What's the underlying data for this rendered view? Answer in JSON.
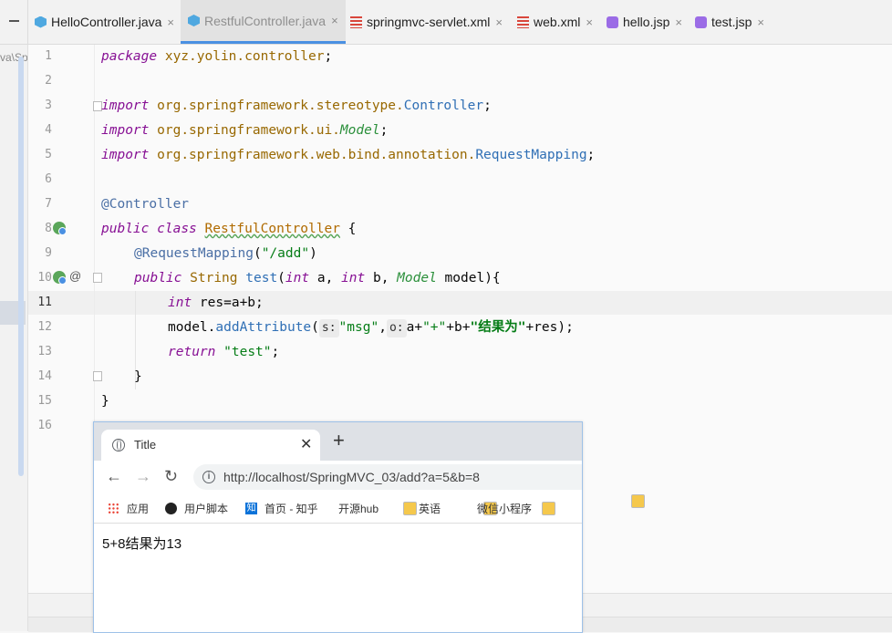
{
  "tabs": [
    {
      "label": "HelloController.java",
      "icon": "java-class-icon",
      "active": false
    },
    {
      "label": "RestfulController.java",
      "icon": "java-class-icon",
      "active": true
    },
    {
      "label": "springmvc-servlet.xml",
      "icon": "xml-file-icon",
      "active": false
    },
    {
      "label": "web.xml",
      "icon": "xml-file-icon",
      "active": false
    },
    {
      "label": "hello.jsp",
      "icon": "jsp-file-icon",
      "active": false
    },
    {
      "label": "test.jsp",
      "icon": "jsp-file-icon",
      "active": false
    }
  ],
  "close_glyph": "×",
  "breadcrumb": "va\\Sp",
  "line_numbers": [
    "1",
    "2",
    "3",
    "4",
    "5",
    "6",
    "7",
    "8",
    "9",
    "10",
    "11",
    "12",
    "13",
    "14",
    "15",
    "16"
  ],
  "current_line": "11",
  "code": {
    "l1_kw": "package",
    "l1_pkg": "xyz.yolin.controller",
    "semi": ";",
    "import_kw": "import",
    "l3_pkg": "org.springframework.stereotype.",
    "l3_cls": "Controller",
    "l4_pkg": "org.springframework.ui.",
    "l4_cls": "Model",
    "l5_pkg": "org.springframework.web.bind.annotation.",
    "l5_cls": "RequestMapping",
    "l7": "@Controller",
    "l8_public": "public",
    "l8_class": "class",
    "l8_name": "RestfulController",
    "l8_brace": " {",
    "l9_ann": "@RequestMapping",
    "l9_open": "(",
    "l9_str": "\"/add\"",
    "l9_close": ")",
    "l10_public": "public",
    "l10_type": "String",
    "l10_fn": "test",
    "l10_open": "(",
    "l10_int1": "int",
    "l10_a": " a, ",
    "l10_int2": "int",
    "l10_b": " b, ",
    "l10_model": "Model",
    "l10_rest": " model){",
    "l11_int": "int",
    "l11_rest": " res=a+b;",
    "l12_model": "model.",
    "l12_fn": "addAttribute",
    "l12_open": "(",
    "l12_hint_s": "s:",
    "l12_msg": "\"msg\"",
    "l12_comma": ",",
    "l12_hint_o": "o:",
    "l12_a": "a+",
    "l12_plus": "\"+\"",
    "l12_b": "+b+",
    "l12_result": "\"结果为\"",
    "l12_rest": "+res);",
    "l13_return": "return",
    "l13_str": "\"test\"",
    "l14": "}",
    "l15": "}"
  },
  "browser": {
    "tab_title": "Title",
    "tab_close": "✕",
    "new_tab": "+",
    "back": "←",
    "forward": "→",
    "reload": "↻",
    "info": "i",
    "url": "http://localhost/SpringMVC_03/add?a=5&b=8",
    "bookmarks": [
      "应用",
      "用户脚本",
      "首页 - 知乎",
      "开源hub",
      "英语",
      "微信小程序"
    ],
    "zhihu_glyph": "知",
    "page_text": "5+8结果为13"
  }
}
